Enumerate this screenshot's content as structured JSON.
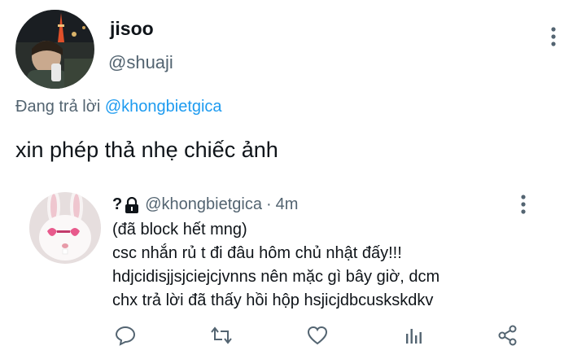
{
  "tweet": {
    "author_name": "jisoo",
    "author_handle": "@shuaji",
    "replying_prefix": "Đang trả lời ",
    "replying_to": "@khongbietgica",
    "text": "xin phép thả nhẹ chiếc ảnh"
  },
  "quoted": {
    "author_name": "?",
    "author_handle": "@khongbietgica",
    "separator": "·",
    "time": "4m",
    "lines": [
      "(đã block hết mng)",
      "csc nhắn rủ t đi đâu hôm chủ nhật đấy!!!",
      "hdjcidisjjsjciejcjvnns nên mặc gì bây giờ, dcm",
      "chx trả lời đã thấy hồi hộp hsjicjdbcuskskdkv"
    ]
  },
  "icons": [
    "more-vertical-icon",
    "lock-icon",
    "reply-icon",
    "retweet-icon",
    "like-icon",
    "analytics-icon",
    "share-icon"
  ],
  "colors": {
    "accent": "#1d9bf0",
    "secondary_text": "#536471",
    "primary_text": "#0f1419"
  }
}
